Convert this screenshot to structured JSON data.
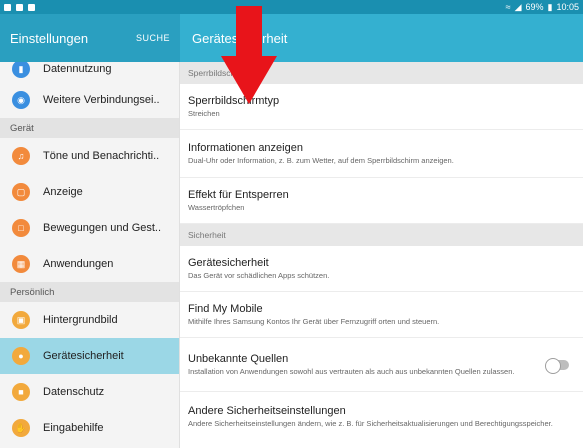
{
  "status_bar": {
    "battery": "69%",
    "time": "10:05"
  },
  "header": {
    "left_title": "Einstellungen",
    "search_action": "SUCHE",
    "right_title": "Gerätesicherheit"
  },
  "sidebar": {
    "items_top": [
      {
        "label": "Datennutzung",
        "icon": "data-usage-icon",
        "color": "#3a8fe0"
      },
      {
        "label": "Weitere Verbindungsei..",
        "icon": "connections-icon",
        "color": "#3a8fe0"
      }
    ],
    "group_geraet": "Gerät",
    "items_geraet": [
      {
        "label": "Töne und Benachrichti..",
        "icon": "sound-icon",
        "color": "#f28a3c"
      },
      {
        "label": "Anzeige",
        "icon": "display-icon",
        "color": "#f28a3c"
      },
      {
        "label": "Bewegungen und Gest..",
        "icon": "motion-icon",
        "color": "#f28a3c"
      },
      {
        "label": "Anwendungen",
        "icon": "apps-icon",
        "color": "#f28a3c"
      }
    ],
    "group_persoenlich": "Persönlich",
    "items_persoenlich": [
      {
        "label": "Hintergrundbild",
        "icon": "wallpaper-icon",
        "color": "#f2a93c"
      },
      {
        "label": "Gerätesicherheit",
        "icon": "lock-icon",
        "color": "#f2a93c"
      },
      {
        "label": "Datenschutz",
        "icon": "privacy-icon",
        "color": "#f2a93c"
      },
      {
        "label": "Eingabehilfe",
        "icon": "accessibility-icon",
        "color": "#f2a93c"
      }
    ]
  },
  "main": {
    "sections": [
      {
        "header": "Sperrbildschirm",
        "rows": [
          {
            "title": "Sperrbildschirmtyp",
            "sub": "Streichen"
          },
          {
            "title": "Informationen anzeigen",
            "sub": "Dual-Uhr oder Information, z. B. zum Wetter, auf dem Sperrbildschirm anzeigen."
          },
          {
            "title": "Effekt für Entsperren",
            "sub": "Wassertröpfchen"
          }
        ]
      },
      {
        "header": "Sicherheit",
        "rows": [
          {
            "title": "Gerätesicherheit",
            "sub": "Das Gerät vor schädlichen Apps schützen."
          },
          {
            "title": "Find My Mobile",
            "sub": "Mithilfe Ihres Samsung Kontos Ihr Gerät über Fernzugriff orten und steuern."
          },
          {
            "title": "Unbekannte Quellen",
            "sub": "Installation von Anwendungen sowohl aus vertrauten als auch aus unbekannten Quellen zulassen.",
            "toggle": "off"
          },
          {
            "title": "Andere Sicherheitseinstellungen",
            "sub": "Andere Sicherheitseinstellungen ändern, wie z. B. für Sicherheitsaktualisierungen und Berechtigungsspeicher."
          }
        ]
      }
    ]
  },
  "annotation": {
    "arrow_color": "#e8141a"
  }
}
